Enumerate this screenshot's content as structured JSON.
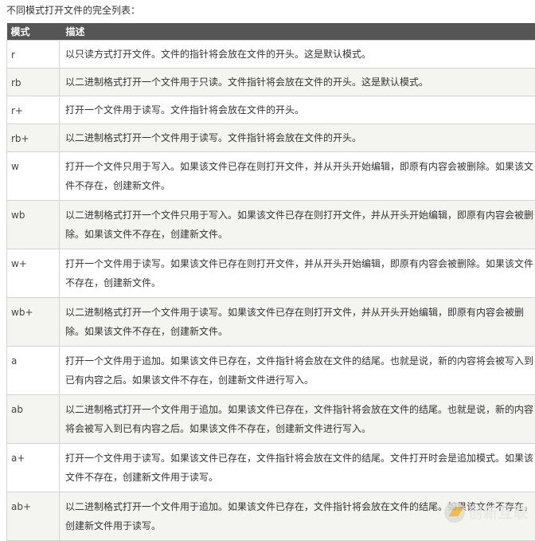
{
  "intro": "不同模式打开文件的完全列表：",
  "table": {
    "headers": [
      "模式",
      "描述"
    ],
    "rows": [
      {
        "mode": "r",
        "desc": "以只读方式打开文件。文件的指针将会放在文件的开头。这是默认模式。"
      },
      {
        "mode": "rb",
        "desc": "以二进制格式打开一个文件用于只读。文件指针将会放在文件的开头。这是默认模式。"
      },
      {
        "mode": "r+",
        "desc": "打开一个文件用于读写。文件指针将会放在文件的开头。"
      },
      {
        "mode": "rb+",
        "desc": "以二进制格式打开一个文件用于读写。文件指针将会放在文件的开头。"
      },
      {
        "mode": "w",
        "desc": "打开一个文件只用于写入。如果该文件已存在则打开文件，并从开头开始编辑，即原有内容会被删除。如果该文件不存在，创建新文件。"
      },
      {
        "mode": "wb",
        "desc": "以二进制格式打开一个文件只用于写入。如果该文件已存在则打开文件，并从开头开始编辑，即原有内容会被删除。如果该文件不存在，创建新文件。"
      },
      {
        "mode": "w+",
        "desc": "打开一个文件用于读写。如果该文件已存在则打开文件，并从开头开始编辑，即原有内容会被删除。如果该文件不存在，创建新文件。"
      },
      {
        "mode": "wb+",
        "desc": "以二进制格式打开一个文件用于读写。如果该文件已存在则打开文件，并从开头开始编辑，即原有内容会被删除。如果该文件不存在，创建新文件。"
      },
      {
        "mode": "a",
        "desc": "打开一个文件用于追加。如果该文件已存在，文件指针将会放在文件的结尾。也就是说，新的内容将会被写入到已有内容之后。如果该文件不存在，创建新文件进行写入。"
      },
      {
        "mode": "ab",
        "desc": "以二进制格式打开一个文件用于追加。如果该文件已存在，文件指针将会放在文件的结尾。也就是说，新的内容将会被写入到已有内容之后。如果该文件不存在，创建新文件进行写入。"
      },
      {
        "mode": "a+",
        "desc": "打开一个文件用于读写。如果该文件已存在，文件指针将会放在文件的结尾。文件打开时会是追加模式。如果该文件不存在，创建新文件用于读写。"
      },
      {
        "mode": "ab+",
        "desc": "以二进制格式打开一个文件用于追加。如果该文件已存在，文件指针将会放在文件的结尾。如果该文件不存在，创建新文件用于读写。"
      }
    ]
  },
  "watermark": "创新互联"
}
